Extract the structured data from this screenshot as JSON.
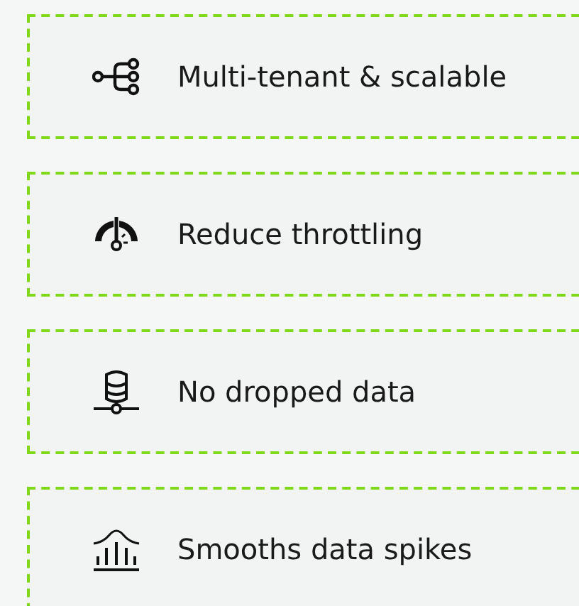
{
  "features": [
    {
      "label": "Multi-tenant & scalable"
    },
    {
      "label": "Reduce throttling"
    },
    {
      "label": "No dropped data"
    },
    {
      "label": "Smooths data spikes"
    }
  ]
}
